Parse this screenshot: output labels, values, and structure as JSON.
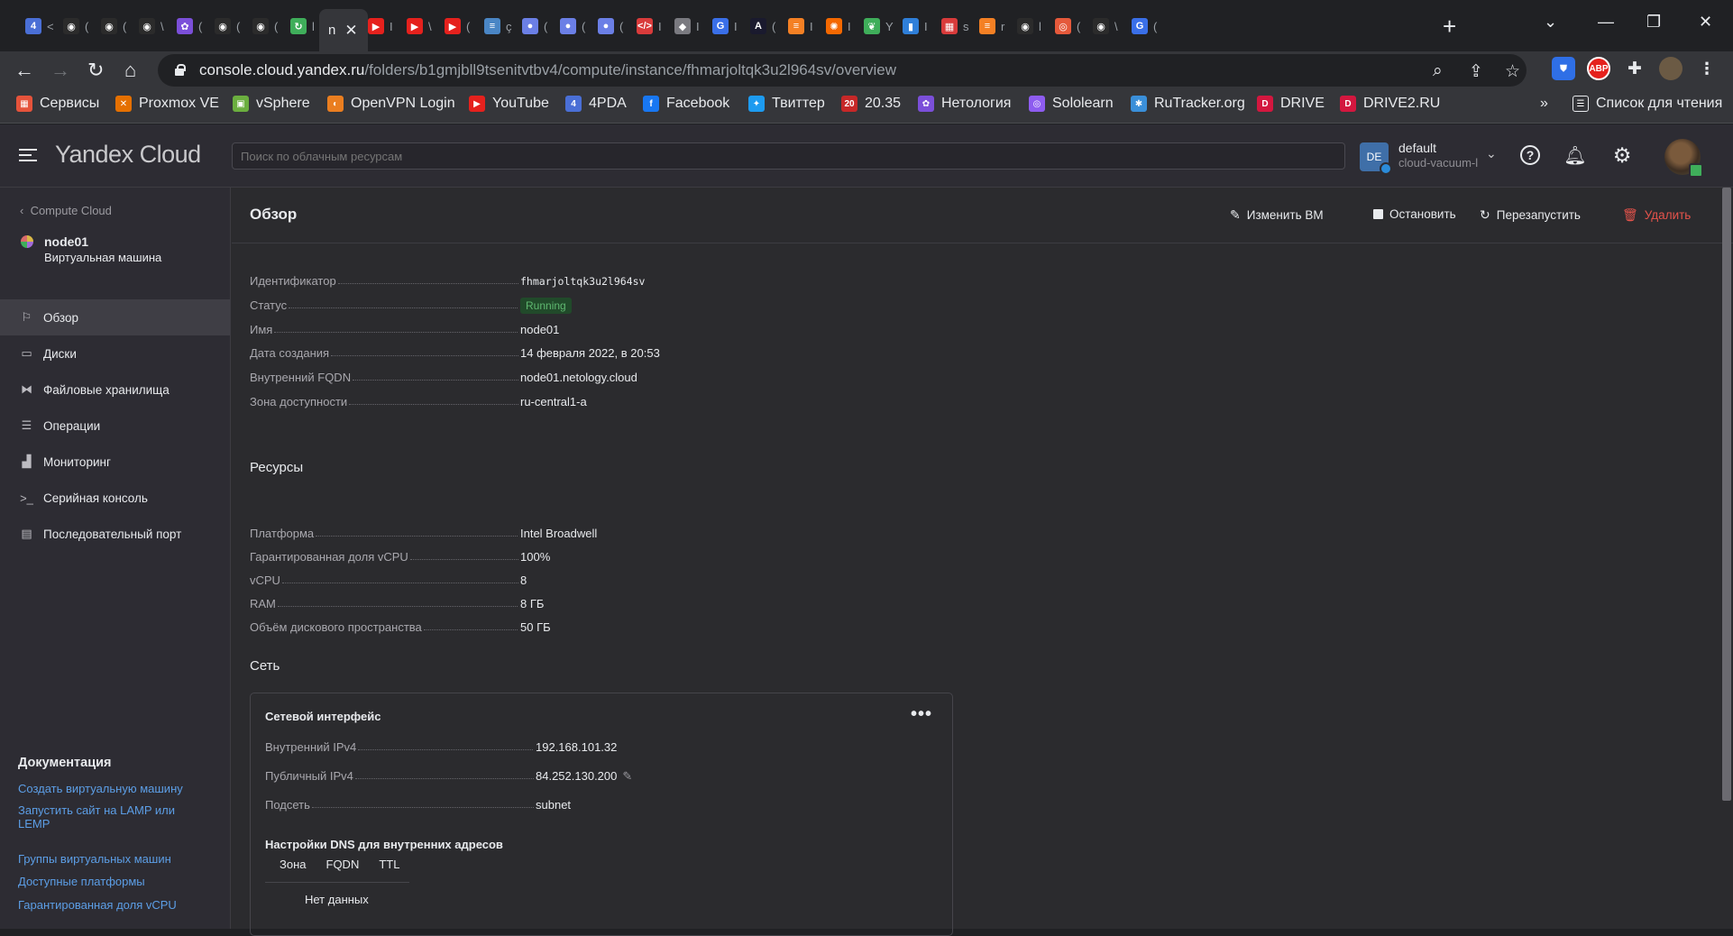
{
  "browser": {
    "tabs": [
      {
        "name": "4pda",
        "fav": "4",
        "color": "#4a6fd6",
        "bit": "<"
      },
      {
        "name": "github-1",
        "fav": "◉",
        "color": "#2b2b2b",
        "bit": "("
      },
      {
        "name": "github-2",
        "fav": "◉",
        "color": "#2b2b2b",
        "bit": "("
      },
      {
        "name": "github-3",
        "fav": "◉",
        "color": "#2b2b2b",
        "bit": "\\"
      },
      {
        "name": "netology",
        "fav": "✿",
        "color": "#7b4fd9",
        "bit": "("
      },
      {
        "name": "github-4",
        "fav": "◉",
        "color": "#2b2b2b",
        "bit": "("
      },
      {
        "name": "github-5",
        "fav": "◉",
        "color": "#2b2b2b",
        "bit": "("
      },
      {
        "name": "refresh",
        "fav": "↻",
        "color": "#3fae5a",
        "bit": "l"
      },
      {
        "name": "active",
        "fav": "",
        "color": "#35363a",
        "bit": "n"
      },
      {
        "name": "youtube-1",
        "fav": "▶",
        "color": "#e5211d",
        "bit": "I"
      },
      {
        "name": "youtube-2",
        "fav": "▶",
        "color": "#e5211d",
        "bit": "\\"
      },
      {
        "name": "youtube-3",
        "fav": "▶",
        "color": "#e5211d",
        "bit": "("
      },
      {
        "name": "stack",
        "fav": "≡",
        "color": "#4a86c5",
        "bit": "ç"
      },
      {
        "name": "blob-1",
        "fav": "●",
        "color": "#6b7fe6",
        "bit": "("
      },
      {
        "name": "blob-2",
        "fav": "●",
        "color": "#6b7fe6",
        "bit": "("
      },
      {
        "name": "blob-3",
        "fav": "●",
        "color": "#6b7fe6",
        "bit": "("
      },
      {
        "name": "code",
        "fav": "</>",
        "color": "#d93b3b",
        "bit": "I"
      },
      {
        "name": "ghost",
        "fav": "◆",
        "color": "#7a7a80",
        "bit": "I"
      },
      {
        "name": "google-1",
        "fav": "G",
        "color": "#3a6fe8",
        "bit": "I"
      },
      {
        "name": "angular",
        "fav": "A",
        "color": "#1a1a2e",
        "bit": "("
      },
      {
        "name": "so-1",
        "fav": "≡",
        "color": "#f48024",
        "bit": "I"
      },
      {
        "name": "grafana",
        "fav": "✺",
        "color": "#f46800",
        "bit": "I"
      },
      {
        "name": "evernote",
        "fav": "❦",
        "color": "#3fae5a",
        "bit": "Y"
      },
      {
        "name": "trello",
        "fav": "▮",
        "color": "#2f7fd9",
        "bit": "I"
      },
      {
        "name": "grid",
        "fav": "▦",
        "color": "#d93b3b",
        "bit": "s"
      },
      {
        "name": "so-2",
        "fav": "≡",
        "color": "#f48024",
        "bit": "r"
      },
      {
        "name": "github-6",
        "fav": "◉",
        "color": "#2b2b2b",
        "bit": "l"
      },
      {
        "name": "podcast",
        "fav": "◎",
        "color": "#e5593b",
        "bit": "("
      },
      {
        "name": "github-7",
        "fav": "◉",
        "color": "#2b2b2b",
        "bit": "\\"
      },
      {
        "name": "google-2",
        "fav": "G",
        "color": "#3a6fe8",
        "bit": "("
      }
    ],
    "url_host": "console.cloud.yandex.ru",
    "url_path": "/folders/b1gmjbll9tsenitvtbv4/compute/instance/fhmarjoltqk3u2l964sv/overview",
    "bookmarks": [
      {
        "label": "Сервисы",
        "icon": "apps-icon",
        "glyph": "▦",
        "color": "#e5533b"
      },
      {
        "label": "Proxmox VE",
        "icon": "proxmox-icon",
        "glyph": "✕",
        "color": "#e57000"
      },
      {
        "label": "vSphere",
        "icon": "vsphere-icon",
        "glyph": "▣",
        "color": "#6bae3f"
      },
      {
        "label": "OpenVPN Login",
        "icon": "openvpn-icon",
        "glyph": "◐",
        "color": "#ea7e20"
      },
      {
        "label": "YouTube",
        "icon": "youtube-icon",
        "glyph": "▶",
        "color": "#e5211d"
      },
      {
        "label": "4PDA",
        "icon": "4pda-icon",
        "glyph": "4",
        "color": "#4a6fd6"
      },
      {
        "label": "Facebook",
        "icon": "facebook-icon",
        "glyph": "f",
        "color": "#1877f2"
      },
      {
        "label": "Твиттер",
        "icon": "twitter-icon",
        "glyph": "✦",
        "color": "#1d9bf0"
      },
      {
        "label": "20.35",
        "icon": "2035-icon",
        "glyph": "20",
        "color": "#c62828"
      },
      {
        "label": "Нетология",
        "icon": "netology-icon",
        "glyph": "✿",
        "color": "#7b4fd9"
      },
      {
        "label": "Sololearn",
        "icon": "sololearn-icon",
        "glyph": "◎",
        "color": "#8e5cf0"
      },
      {
        "label": "RuTracker.org",
        "icon": "rutracker-icon",
        "glyph": "✱",
        "color": "#3a8fd9"
      },
      {
        "label": "DRIVE",
        "icon": "drive-icon",
        "glyph": "D",
        "color": "#d3173f"
      },
      {
        "label": "DRIVE2.RU",
        "icon": "drive2-icon",
        "glyph": "D",
        "color": "#d3173f"
      }
    ],
    "more_bookmarks": "»",
    "reading_list": "Список для чтения",
    "extensions": {
      "abp": "ABP"
    }
  },
  "app": {
    "logo": "Yandex Cloud",
    "search_placeholder": "Поиск по облачным ресурсам",
    "account": {
      "badge": "DE",
      "name": "default",
      "cloud": "cloud-vacuum-l"
    }
  },
  "sidebar": {
    "back": "Compute Cloud",
    "node_name": "node01",
    "node_type": "Виртуальная машина",
    "items": [
      {
        "label": "Обзор",
        "icon": "flag-icon",
        "glyph": "⚐",
        "active": true
      },
      {
        "label": "Диски",
        "icon": "disk-icon",
        "glyph": "▭",
        "active": false
      },
      {
        "label": "Файловые хранилища",
        "icon": "file-storage-icon",
        "glyph": "⧓",
        "active": false
      },
      {
        "label": "Операции",
        "icon": "operations-icon",
        "glyph": "☰",
        "active": false
      },
      {
        "label": "Мониторинг",
        "icon": "monitoring-icon",
        "glyph": "▟",
        "active": false
      },
      {
        "label": "Серийная консоль",
        "icon": "console-icon",
        "glyph": ">_",
        "active": false
      },
      {
        "label": "Последовательный порт",
        "icon": "port-icon",
        "glyph": "▤",
        "active": false
      }
    ],
    "docs_title": "Документация",
    "docs": [
      "Создать виртуальную машину",
      "Запустить сайт на LAMP или LEMP",
      "Группы виртуальных машин",
      "Доступные платформы",
      "Гарантированная доля vCPU"
    ]
  },
  "main": {
    "title": "Обзор",
    "actions": {
      "edit": "Изменить ВМ",
      "stop": "Остановить",
      "restart": "Перезапустить",
      "delete": "Удалить"
    },
    "overview": [
      {
        "key": "Идентификатор",
        "value": "fhmarjoltqk3u2l964sv"
      },
      {
        "key": "Статус",
        "value": "Running"
      },
      {
        "key": "Имя",
        "value": "node01"
      },
      {
        "key": "Дата создания",
        "value": "14 февраля 2022, в 20:53"
      },
      {
        "key": "Внутренний FQDN",
        "value": "node01.netology.cloud"
      },
      {
        "key": "Зона доступности",
        "value": "ru-central1-a"
      }
    ],
    "resources_title": "Ресурсы",
    "resources": [
      {
        "key": "Платформа",
        "value": "Intel Broadwell"
      },
      {
        "key": "Гарантированная доля vCPU",
        "value": "100%"
      },
      {
        "key": "vCPU",
        "value": "8"
      },
      {
        "key": "RAM",
        "value": "8 ГБ"
      },
      {
        "key": "Объём дискового пространства",
        "value": "50 ГБ"
      }
    ],
    "network_title": "Сеть",
    "network": {
      "card_title": "Сетевой интерфейс",
      "more": "•••",
      "internal_ipv4_key": "Внутренний IPv4",
      "internal_ipv4": "192.168.101.32",
      "public_ipv4_key": "Публичный IPv4",
      "public_ipv4": "84.252.130.200",
      "subnet_key": "Подсеть",
      "subnet": "subnet",
      "dns_title": "Настройки DNS для внутренних адресов",
      "dns_columns": [
        "Зона",
        "FQDN",
        "TTL"
      ],
      "dns_empty": "Нет данных"
    }
  }
}
